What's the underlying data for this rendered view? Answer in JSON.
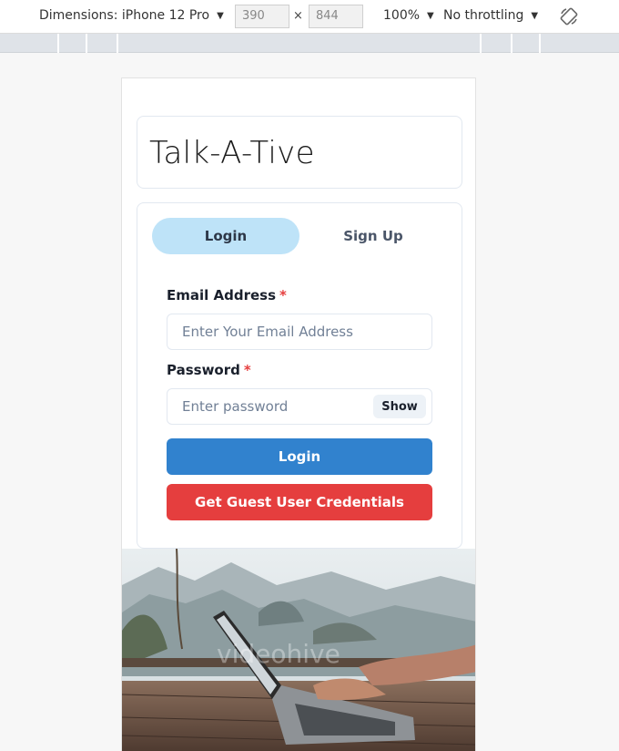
{
  "devtools": {
    "dimensions_label": "Dimensions: iPhone 12 Pro",
    "width_value": "390",
    "height_value": "844",
    "times_symbol": "×",
    "zoom": "100%",
    "throttling": "No throttling"
  },
  "app": {
    "title": "Talk-A-Tive"
  },
  "tabs": [
    {
      "label": "Login",
      "active": true
    },
    {
      "label": "Sign Up",
      "active": false
    }
  ],
  "form": {
    "email_label": "Email Address",
    "email_placeholder": "Enter Your Email Address",
    "password_label": "Password",
    "password_placeholder": "Enter password",
    "required_mark": "*",
    "show_label": "Show",
    "login_button": "Login",
    "guest_button": "Get Guest User Credentials"
  },
  "background": {
    "watermark": "videohive"
  },
  "colors": {
    "tab_active_bg": "#bee3f8",
    "login_button": "#3182ce",
    "guest_button": "#e53e3e",
    "required": "#e53e3e"
  }
}
